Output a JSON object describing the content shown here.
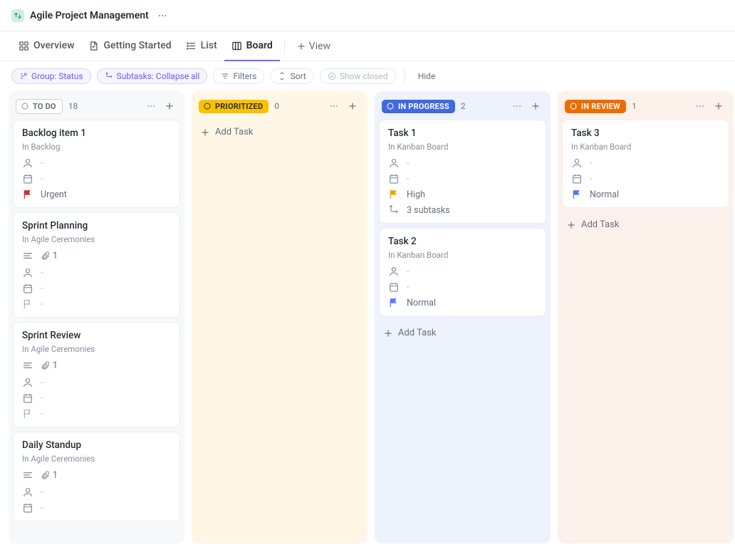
{
  "header": {
    "title": "Agile Project Management"
  },
  "tabs": {
    "overview": "Overview",
    "getting_started": "Getting Started",
    "list": "List",
    "board": "Board",
    "add_view": "View"
  },
  "toolbar": {
    "group_status": "Group: Status",
    "subtasks": "Subtasks: Collapse all",
    "filters": "Filters",
    "sort": "Sort",
    "show_closed": "Show closed",
    "hide": "Hide"
  },
  "add_task_label": "Add Task",
  "columns": {
    "todo": {
      "label": "TO DO",
      "count": "18",
      "cards": [
        {
          "title": "Backlog item 1",
          "location": "In Backlog",
          "priority": "Urgent",
          "priority_class": "flag-urgent",
          "assignee": "-",
          "date": "-",
          "has_desc_attach": false
        },
        {
          "title": "Sprint Planning",
          "location": "In Agile Ceremonies",
          "priority": "",
          "priority_class": "flag-empty",
          "assignee": "-",
          "date": "-",
          "has_desc_attach": true,
          "attach": "1"
        },
        {
          "title": "Sprint Review",
          "location": "In Agile Ceremonies",
          "priority": "",
          "priority_class": "flag-empty",
          "assignee": "-",
          "date": "-",
          "has_desc_attach": true,
          "attach": "1"
        },
        {
          "title": "Daily Standup",
          "location": "In Agile Ceremonies",
          "priority": "",
          "priority_class": "flag-empty",
          "assignee": "-",
          "date": "-",
          "has_desc_attach": true,
          "attach": "1"
        }
      ]
    },
    "prioritized": {
      "label": "PRIORITIZED",
      "count": "0"
    },
    "inprogress": {
      "label": "IN PROGRESS",
      "count": "2",
      "cards": [
        {
          "title": "Task 1",
          "location": "In Kanban Board",
          "priority": "High",
          "priority_class": "flag-high",
          "assignee": "-",
          "date": "-",
          "subtasks": "3 subtasks"
        },
        {
          "title": "Task 2",
          "location": "In Kanban Board",
          "priority": "Normal",
          "priority_class": "flag-normal",
          "assignee": "-",
          "date": "-"
        }
      ]
    },
    "inreview": {
      "label": "IN REVIEW",
      "count": "1",
      "cards": [
        {
          "title": "Task 3",
          "location": "In Kanban Board",
          "priority": "Normal",
          "priority_class": "flag-normal",
          "assignee": "-",
          "date": "-"
        }
      ]
    }
  }
}
